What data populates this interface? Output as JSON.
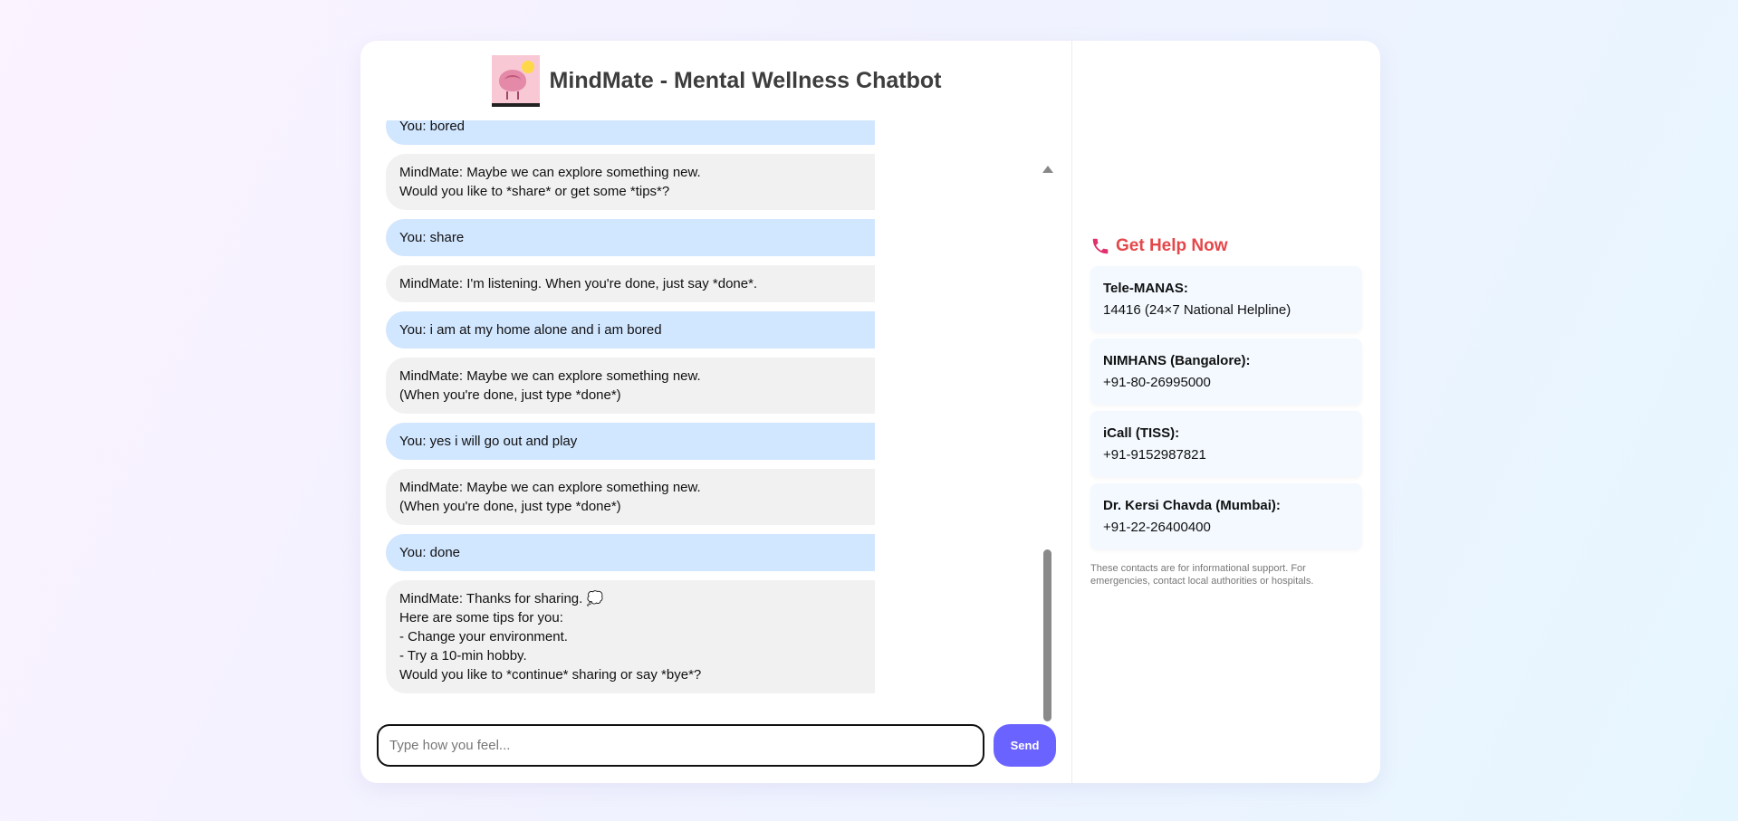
{
  "header": {
    "title": "MindMate - Mental Wellness Chatbot"
  },
  "messages": [
    {
      "role": "user",
      "text": "You: bored"
    },
    {
      "role": "bot",
      "text": "MindMate: Maybe we can explore something new.\nWould you like to *share* or get some *tips*?"
    },
    {
      "role": "user",
      "text": "You: share"
    },
    {
      "role": "bot",
      "text": "MindMate: I'm listening. When you're done, just say *done*."
    },
    {
      "role": "user",
      "text": "You: i am at my home alone and i am bored"
    },
    {
      "role": "bot",
      "text": "MindMate: Maybe we can explore something new.\n(When you're done, just type *done*)"
    },
    {
      "role": "user",
      "text": "You: yes i will go out and play"
    },
    {
      "role": "bot",
      "text": "MindMate: Maybe we can explore something new.\n(When you're done, just type *done*)"
    },
    {
      "role": "user",
      "text": "You: done"
    },
    {
      "role": "bot",
      "text": "MindMate: Thanks for sharing. 💭\nHere are some tips for you:\n- Change your environment.\n- Try a 10-min hobby.\nWould you like to *continue* sharing or say *bye*?"
    }
  ],
  "input": {
    "placeholder": "Type how you feel...",
    "value": "",
    "send_label": "Send"
  },
  "help": {
    "title": "Get Help Now",
    "icon": "phone-icon",
    "contacts": [
      {
        "name": "Tele-MANAS:",
        "number": "14416 (24×7 National Helpline)"
      },
      {
        "name": "NIMHANS (Bangalore):",
        "number": "+91-80-26995000"
      },
      {
        "name": "iCall (TISS):",
        "number": "+91-9152987821"
      },
      {
        "name": "Dr. Kersi Chavda (Mumbai):",
        "number": "+91-22-26400400"
      }
    ],
    "disclaimer": "These contacts are for informational support. For emergencies, contact local authorities or hospitals."
  },
  "colors": {
    "accent": "#6b63ff",
    "user_bubble": "#d1e6ff",
    "bot_bubble": "#f1f1f1",
    "help_title": "#e4474a",
    "contact_bg": "#f3f9ff"
  }
}
